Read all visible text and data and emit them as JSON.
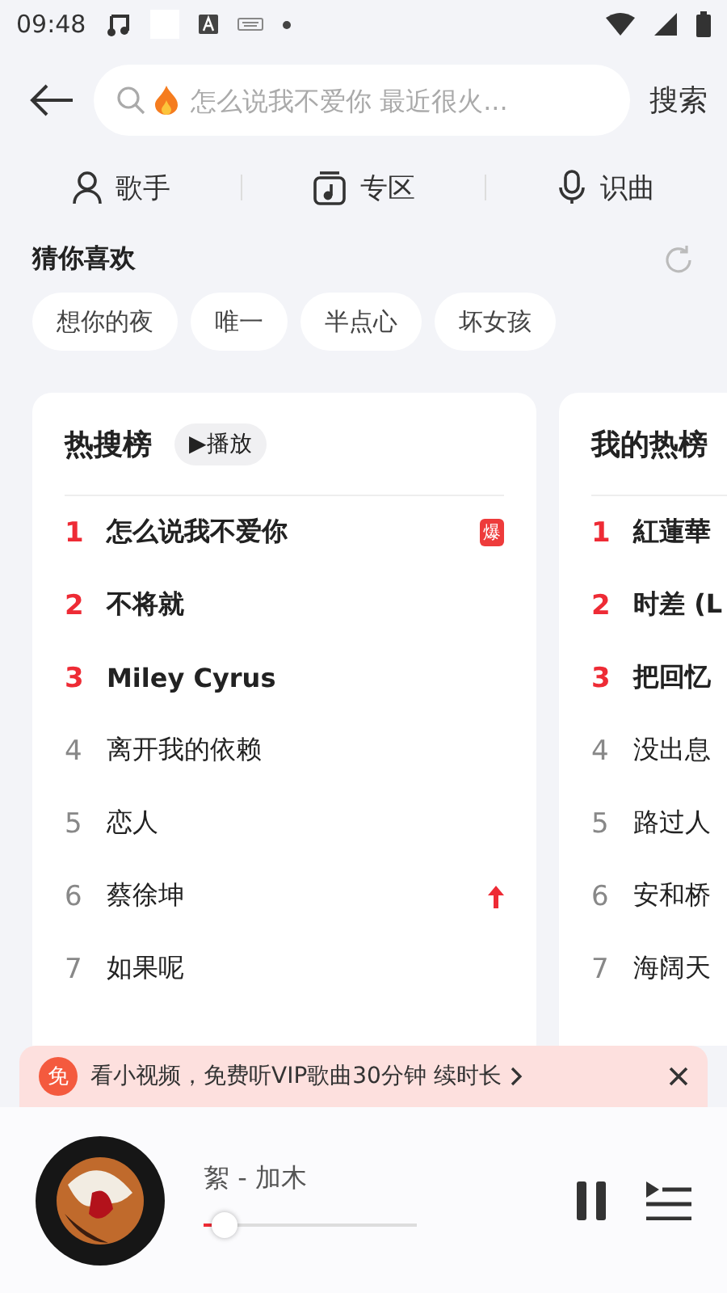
{
  "status_bar": {
    "time": "09:48"
  },
  "search": {
    "placeholder": "怎么说我不爱你 最近很火...",
    "button": "搜索"
  },
  "shortcuts": [
    {
      "kind": "singer",
      "label": "歌手"
    },
    {
      "kind": "zone",
      "label": "专区"
    },
    {
      "kind": "mic",
      "label": "识曲"
    }
  ],
  "recommend": {
    "title": "猜你喜欢",
    "chips": [
      "想你的夜",
      "唯一",
      "半点心",
      "坏女孩"
    ]
  },
  "charts": [
    {
      "title": "热搜榜",
      "play": "▶播放",
      "rows": [
        {
          "rank": "1",
          "title": "怎么说我不爱你",
          "top": true,
          "badge": {
            "kind": "text",
            "text": "爆"
          }
        },
        {
          "rank": "2",
          "title": "不将就",
          "top": true
        },
        {
          "rank": "3",
          "title": "Miley Cyrus",
          "top": true
        },
        {
          "rank": "4",
          "title": "离开我的依赖",
          "top": false
        },
        {
          "rank": "5",
          "title": "恋人",
          "top": false
        },
        {
          "rank": "6",
          "title": "蔡徐坤",
          "top": false,
          "badge": {
            "kind": "up"
          }
        },
        {
          "rank": "7",
          "title": "如果呢",
          "top": false
        }
      ]
    },
    {
      "title": "我的热榜",
      "rows": [
        {
          "rank": "1",
          "title": "紅蓮華",
          "top": true
        },
        {
          "rank": "2",
          "title": "时差 (L",
          "top": true
        },
        {
          "rank": "3",
          "title": "把回忆",
          "top": true
        },
        {
          "rank": "4",
          "title": "没出息",
          "top": false
        },
        {
          "rank": "5",
          "title": "路过人",
          "top": false
        },
        {
          "rank": "6",
          "title": "安和桥",
          "top": false
        },
        {
          "rank": "7",
          "title": "海阔天",
          "top": false
        }
      ]
    }
  ],
  "banner": {
    "badge": "免",
    "text": "看小视频，免费听VIP歌曲30分钟 续时长"
  },
  "player": {
    "track": "絮 - 加木",
    "level": 0.05,
    "playing": true
  }
}
